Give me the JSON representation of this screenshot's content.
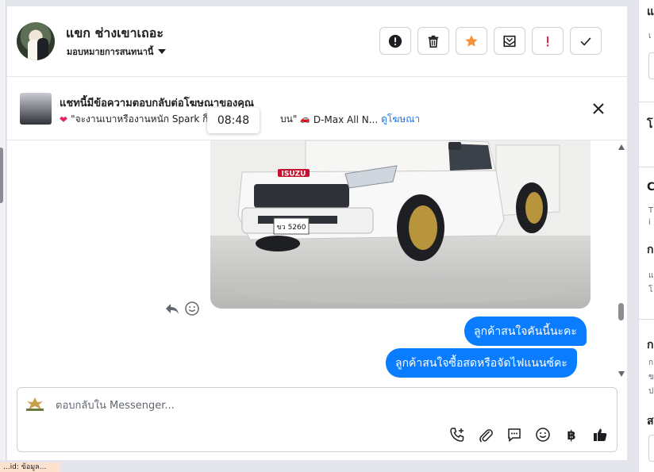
{
  "header": {
    "contact_name": "แขก ช่างเขาเถอะ",
    "assign_label": "มอบหมายการสนทนานี้",
    "actions": [
      {
        "name": "alert-circle-icon",
        "color": "#1c1e21"
      },
      {
        "name": "trash-icon",
        "color": "#1c1e21"
      },
      {
        "name": "star-icon",
        "color": "#f7923a"
      },
      {
        "name": "mail-icon",
        "color": "#1c1e21"
      },
      {
        "name": "exclamation-icon",
        "color": "#e41e3f"
      },
      {
        "name": "check-icon",
        "color": "#1c1e21"
      }
    ]
  },
  "ad_banner": {
    "title": "แชทนี้มีข้อความตอบกลับต่อโฆษณาของคุณ",
    "snippet": "\"จะงานเบาหรืองานหนัก Spark ก็วิ่ง",
    "snippet_tail": "บน\"",
    "ad_name": "D-Max All N...",
    "view_ad_link": "ดูโฆษณา",
    "time_tooltip": "08:48"
  },
  "conversation": {
    "car_plate": "ขว 5260",
    "car_brand": "ISUZU",
    "messages": [
      {
        "text": "ลูกค้าสนใจคันนี้นะคะ",
        "from": "page"
      },
      {
        "text": "ลูกค้าสนใจซื้อสดหรือจัดไฟแนนซ์คะ",
        "from": "page"
      }
    ]
  },
  "composer": {
    "placeholder": "ตอบกลับใน Messenger...",
    "tools": [
      "phone-plus-icon",
      "paperclip-icon",
      "chat-bubble-icon",
      "smiley-icon",
      "baht-icon",
      "thumbs-up-icon"
    ],
    "baht_symbol": "฿"
  },
  "right_panel": {
    "fragments": [
      "แ",
      "เ",
      "โ",
      "C",
      "T",
      "i",
      "ก",
      "แ",
      "โ",
      "ก",
      "ก",
      "ข",
      "ป",
      "ส"
    ]
  },
  "bottom": {
    "chip_text": "...id: ข้อมูล..."
  },
  "colors": {
    "accent": "#0a7cff",
    "link": "#1877f2",
    "star": "#f7923a",
    "alert": "#e41e3f"
  }
}
